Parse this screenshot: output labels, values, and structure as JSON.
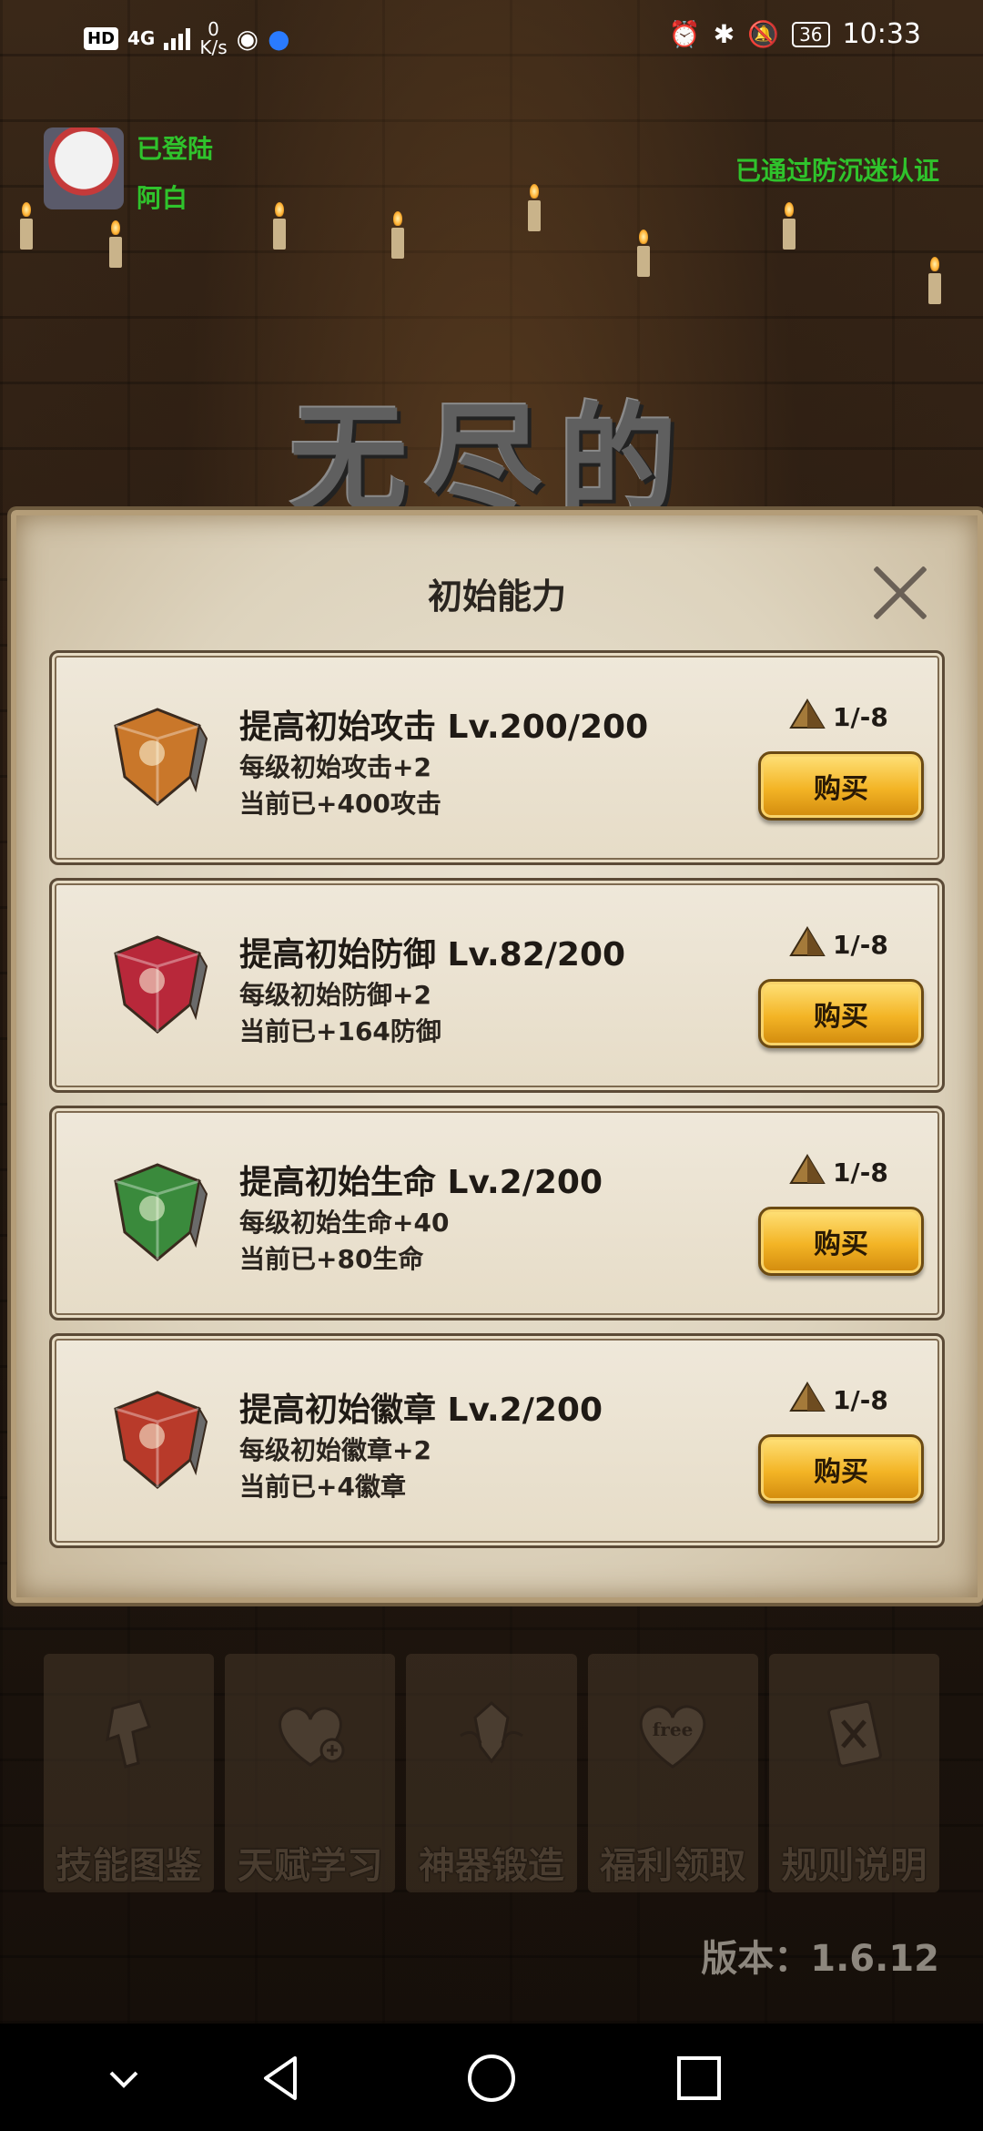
{
  "status_bar": {
    "left_hd": "HD",
    "left_signal": "4G",
    "net_speed_top": "0",
    "net_speed_bottom": "K/s",
    "battery": "36",
    "time": "10:33"
  },
  "user": {
    "login_status": "已登陆",
    "username": "阿白",
    "anti_addiction": "已通过防沉迷认证"
  },
  "background_title": "无尽的",
  "modal": {
    "title": "初始能力",
    "items": [
      {
        "title": "提高初始攻击 Lv.200/200",
        "per_level": "每级初始攻击+2",
        "current": "当前已+400攻击",
        "cost": "1/-8",
        "buy_label": "购买",
        "gem_color": "#c9772a"
      },
      {
        "title": "提高初始防御 Lv.82/200",
        "per_level": "每级初始防御+2",
        "current": "当前已+164防御",
        "cost": "1/-8",
        "buy_label": "购买",
        "gem_color": "#b8283a"
      },
      {
        "title": "提高初始生命 Lv.2/200",
        "per_level": "每级初始生命+40",
        "current": "当前已+80生命",
        "cost": "1/-8",
        "buy_label": "购买",
        "gem_color": "#3a8a3c"
      },
      {
        "title": "提高初始徽章 Lv.2/200",
        "per_level": "每级初始徽章+2",
        "current": "当前已+4徽章",
        "cost": "1/-8",
        "buy_label": "购买",
        "gem_color": "#b83a2a"
      }
    ]
  },
  "bottom_menu": [
    {
      "label": "技能图鉴",
      "icon": "skill-book-icon"
    },
    {
      "label": "天赋学习",
      "icon": "heart-plus-icon"
    },
    {
      "label": "神器锻造",
      "icon": "artifact-forge-icon"
    },
    {
      "label": "福利领取",
      "icon": "free-heart-icon",
      "icon_text": "free"
    },
    {
      "label": "规则说明",
      "icon": "rules-card-icon"
    }
  ],
  "version": "版本：1.6.12"
}
